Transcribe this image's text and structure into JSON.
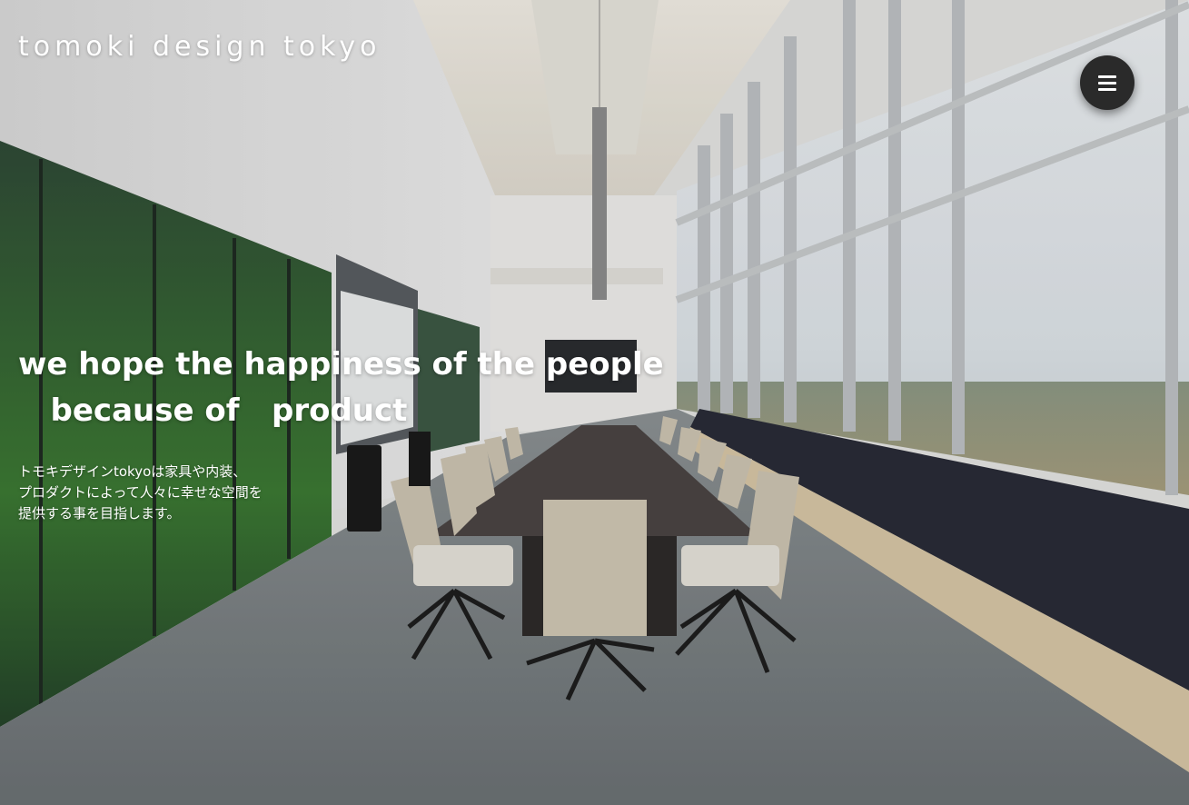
{
  "header": {
    "logo_text": "tomoki design tokyo",
    "menu_icon": "hamburger-menu-icon"
  },
  "hero": {
    "headline_lines": [
      "we hope the happiness of the people",
      "   because of   product"
    ],
    "description_lines": [
      "トモキデザインtokyoは家具や内装、",
      "プロダクトによって人々に幸せな空間を",
      "提供する事を目指します。"
    ],
    "background_image": "conference-room-photo"
  },
  "colors": {
    "text": "#ffffff",
    "menu_button_bg": "#2a2a2a"
  }
}
